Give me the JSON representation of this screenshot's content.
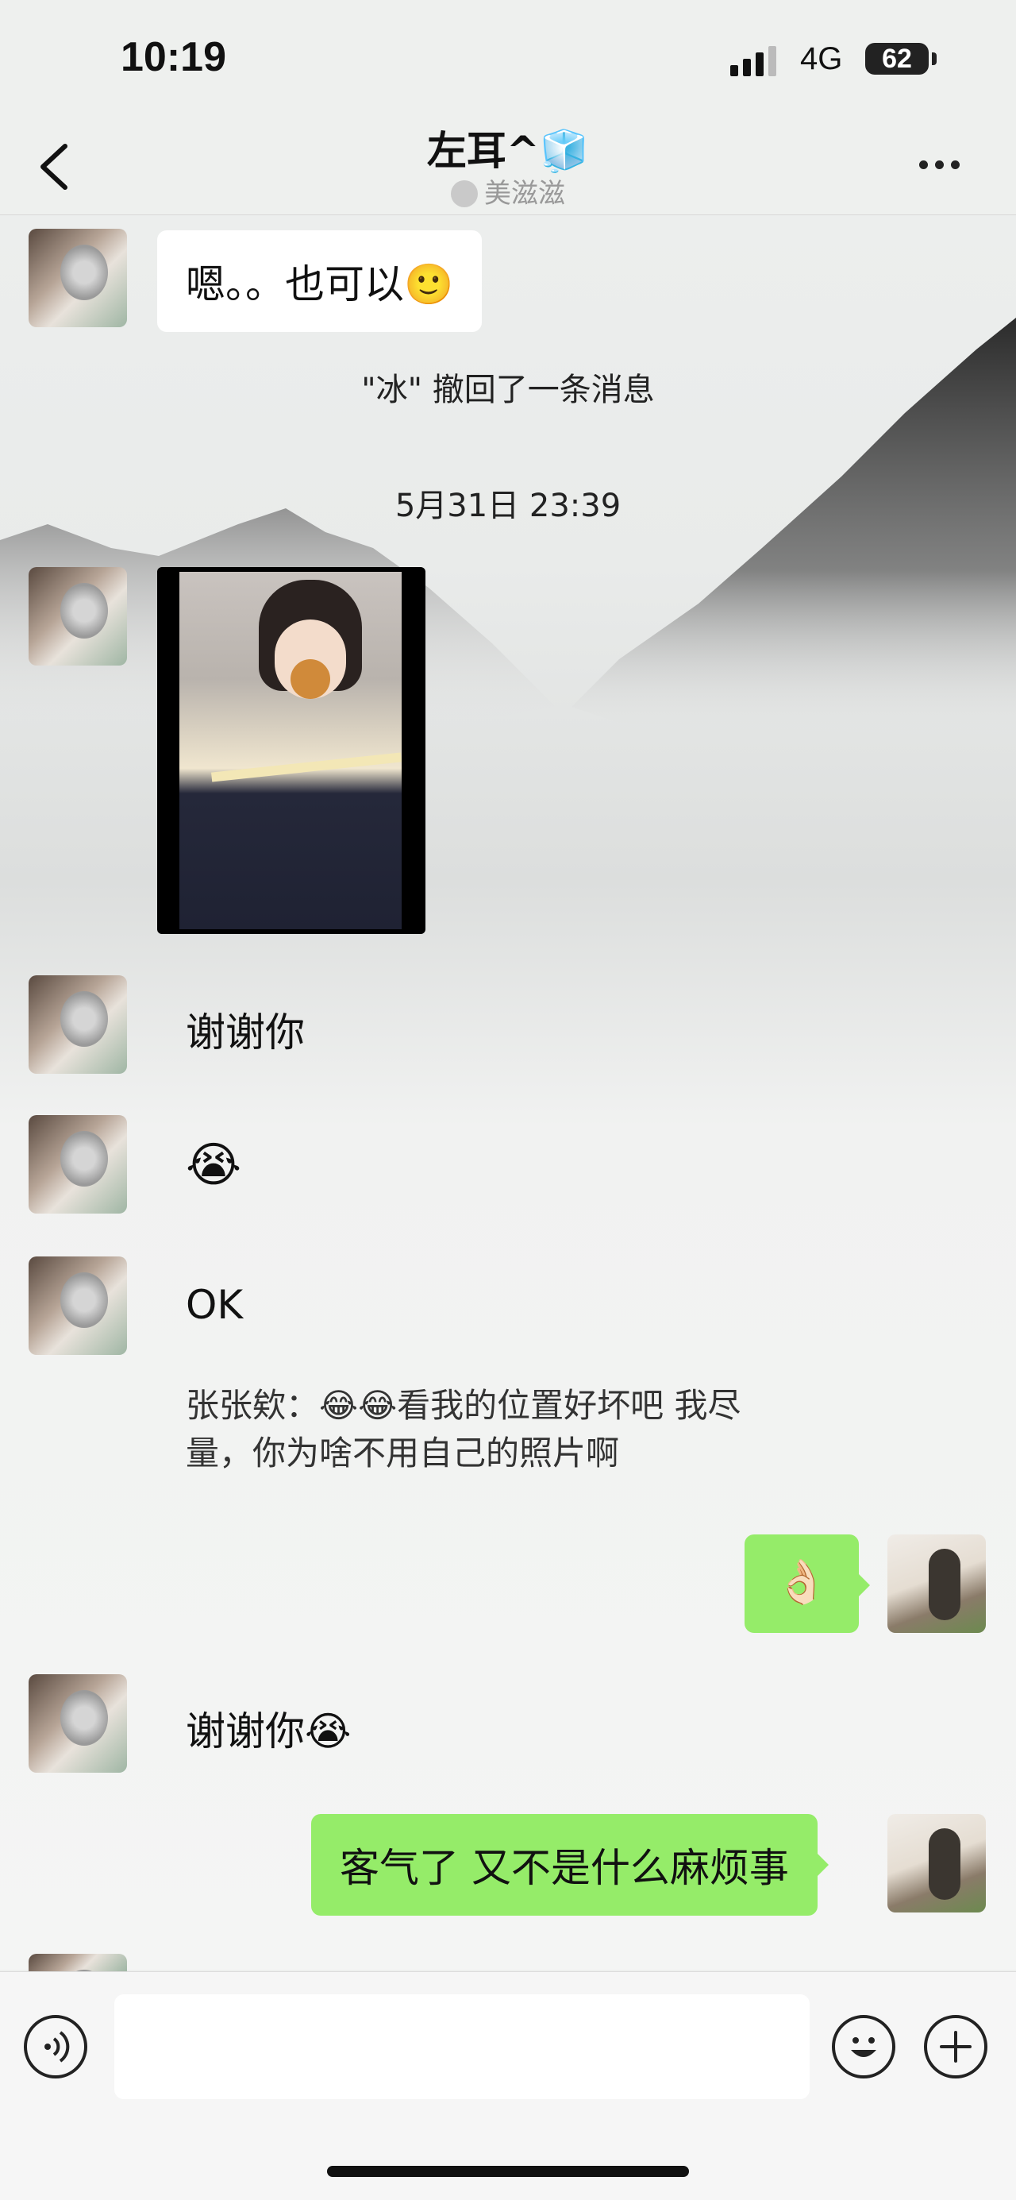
{
  "status_bar": {
    "time": "10:19",
    "network": "4G",
    "battery": "62"
  },
  "header": {
    "title": "左耳^🧊",
    "subtitle": "美滋滋"
  },
  "messages": [
    {
      "side": "left",
      "type": "text_bubble",
      "text": "嗯。。也可以🙂"
    },
    {
      "type": "system",
      "text": "\"冰\" 撤回了一条消息"
    },
    {
      "type": "timestamp",
      "text": "5月31日 23:39"
    },
    {
      "side": "left",
      "type": "image"
    },
    {
      "side": "left",
      "type": "text",
      "text": "谢谢你"
    },
    {
      "side": "left",
      "type": "text",
      "text": "😭"
    },
    {
      "side": "left",
      "type": "text",
      "text": "OK"
    },
    {
      "side": "left",
      "type": "quote",
      "text": "张张欸：😂😂看我的位置好坏吧 我尽量，你为啥不用自己的照片啊"
    },
    {
      "side": "right",
      "type": "text_bubble",
      "text": "👌🏻"
    },
    {
      "side": "left",
      "type": "text",
      "text": "谢谢你😭"
    },
    {
      "side": "right",
      "type": "text_bubble",
      "text": "客气了 又不是什么麻烦事"
    }
  ],
  "colors": {
    "bubble_self": "#95ec69",
    "bubble_other": "#ffffff",
    "background": "#eef0ee"
  },
  "icons": {
    "back": "chevron-left-icon",
    "more": "more-icon",
    "voice": "voice-icon",
    "emoji": "emoji-icon",
    "plus": "plus-icon"
  }
}
